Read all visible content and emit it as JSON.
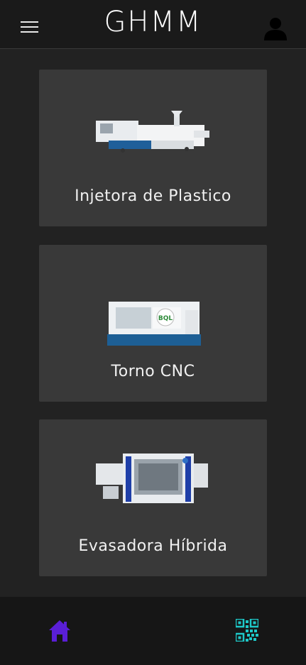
{
  "header": {
    "title": "GHMM",
    "menu_icon": "hamburger-menu-icon",
    "user_icon": "user-icon"
  },
  "machines": [
    {
      "label": "Injetora de Plastico",
      "image": "injection-molding-machine-image"
    },
    {
      "label": "Torno CNC",
      "image": "cnc-lathe-machine-image",
      "badge": "BQL"
    },
    {
      "label": "Evasadora Híbrida",
      "image": "hybrid-bottling-machine-image"
    }
  ],
  "bottom_nav": {
    "home_icon": "home-icon",
    "qr_icon": "qr-code-icon"
  },
  "colors": {
    "background": "#222222",
    "header": "#1a1a1a",
    "card": "#393939",
    "nav": "#161616",
    "home_accent": "#5a1fd6",
    "qr_accent": "#1ec8c8"
  }
}
